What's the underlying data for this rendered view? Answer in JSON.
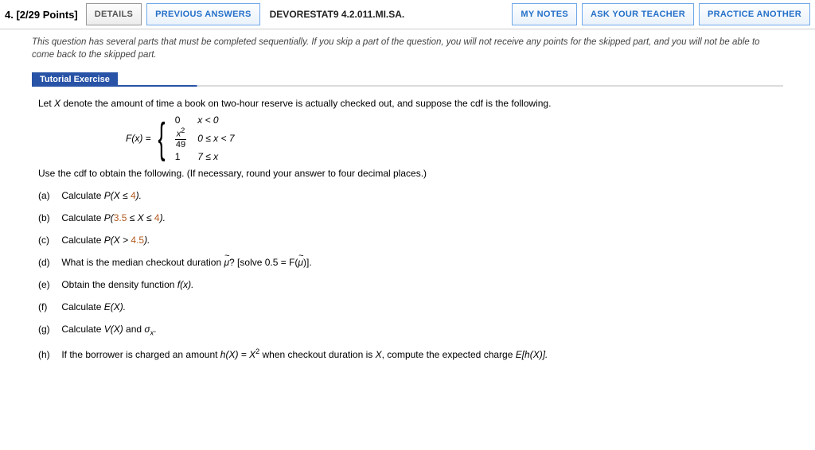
{
  "header": {
    "qnum": "4.",
    "points": "[2/29 Points]",
    "details": "DETAILS",
    "prev": "PREVIOUS ANSWERS",
    "source": "DEVORESTAT9 4.2.011.MI.SA.",
    "notes": "MY NOTES",
    "ask": "ASK YOUR TEACHER",
    "practice": "PRACTICE ANOTHER"
  },
  "note": "This question has several parts that must be completed sequentially. If you skip a part of the question, you will not receive any points for the skipped part, and you will not be able to come back to the skipped part.",
  "tutorial": "Tutorial Exercise",
  "stem1a": "Let ",
  "stem1var": "X",
  "stem1b": " denote the amount of time a book on two-hour reserve is actually checked out, and suppose the cdf is the following.",
  "pw": {
    "lhs": "F(x) =",
    "r1v": "0",
    "r1c": "x < 0",
    "r2num": "x",
    "r2den": "49",
    "r2c": "0 ≤ x < 7",
    "r3v": "1",
    "r3c": "7 ≤ x"
  },
  "stem2": "Use the cdf to obtain the following. (If necessary, round your answer to four decimal places.)",
  "parts": {
    "a_pre": "Calculate ",
    "a_mid": "P(X ≤ ",
    "a_num": "4",
    "a_post": ").",
    "b_pre": "Calculate ",
    "b_mid1": "P(",
    "b_n1": "3.5",
    "b_mid2": " ≤ X ≤ ",
    "b_n2": "4",
    "b_post": ").",
    "c_pre": "Calculate ",
    "c_mid": "P(X > ",
    "c_num": "4.5",
    "c_post": ").",
    "d_pre": "What is the median checkout duration ",
    "d_post": "? [solve 0.5 = F(",
    "e": "Obtain the density function ",
    "e_fx": "f(x).",
    "f": "Calculate ",
    "f_ex": "E(X).",
    "g_pre": "Calculate ",
    "g_mid": "V(X)",
    "g_and": " and ",
    "h_pre": "If the borrower is charged an amount ",
    "h_h": "h(X) = X",
    "h_mid": " when checkout duration is ",
    "h_x": "X",
    "h_post": ", compute the expected charge ",
    "h_e": "E[h(X)]."
  },
  "labels": {
    "a": "(a)",
    "b": "(b)",
    "c": "(c)",
    "d": "(d)",
    "e": "(e)",
    "f": "(f)",
    "g": "(g)",
    "h": "(h)"
  }
}
